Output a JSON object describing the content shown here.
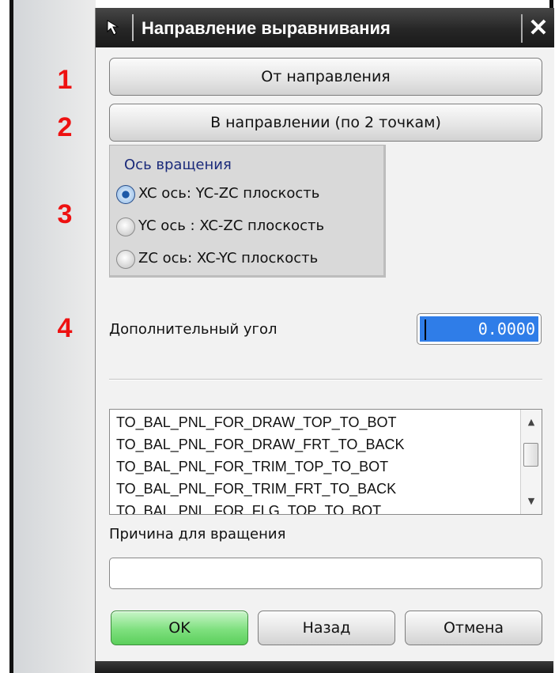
{
  "annotations": [
    "1",
    "2",
    "3",
    "4"
  ],
  "dialog": {
    "title": "Направление выравнивания",
    "close_glyph": "✕"
  },
  "buttons": {
    "from_direction": "От направления",
    "to_direction": "В направлении (по 2 точкам)"
  },
  "rotation_axis": {
    "title": "Ось вращения",
    "options": [
      {
        "label": "XC ось:  YC-ZC плоскость",
        "selected": true
      },
      {
        "label": "YC ось : XC-ZC плоскость",
        "selected": false
      },
      {
        "label": "ZC ось: XC-YC плоскость",
        "selected": false
      }
    ]
  },
  "additional_angle": {
    "label": "Дополнительный угол",
    "value": "0.0000"
  },
  "reasons_list": {
    "items": [
      "TO_BAL_PNL_FOR_DRAW_TOP_TO_BOT",
      "TO_BAL_PNL_FOR_DRAW_FRT_TO_BACK",
      "TO_BAL_PNL_FOR_TRIM_TOP_TO_BOT",
      "TO_BAL_PNL_FOR_TRIM_FRT_TO_BACK",
      "TO_BAL_PNL_FOR_FLG_TOP_TO_BOT"
    ]
  },
  "rotation_reason": {
    "label": "Причина для вращения",
    "value": ""
  },
  "footer": {
    "ok": "OK",
    "back": "Назад",
    "cancel": "Отмена"
  },
  "colors": {
    "annotation": "#ee1111",
    "titlebar": "#262626",
    "ok_button": "#7fe07f",
    "input_highlight": "#2f7de8"
  }
}
